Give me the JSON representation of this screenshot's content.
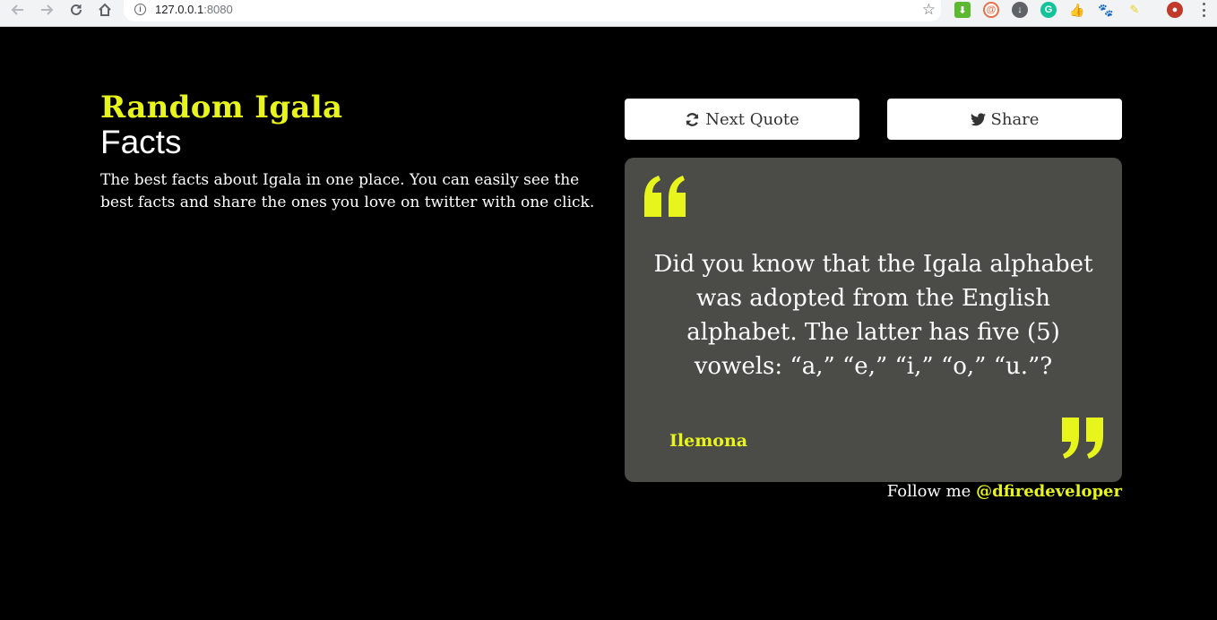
{
  "browser": {
    "url_host": "127.0.0.1",
    "url_port": ":8080",
    "back_icon": "arrow-left-icon",
    "forward_icon": "arrow-right-icon",
    "reload_icon": "reload-icon",
    "home_icon": "home-icon",
    "bookmark_icon": "star-icon",
    "extensions": [
      "download-extension-icon",
      "at-extension-icon",
      "circle-download-icon",
      "grammarly-icon",
      "thumbs-up-icon",
      "paw-icon",
      "sticky-note-icon",
      "profile-avatar"
    ]
  },
  "header": {
    "title_accent": "Random Igala",
    "title_rest": "Facts",
    "description": "The best facts about Igala in one place. You can easily see the best facts and share the ones you love on twitter with one click."
  },
  "actions": {
    "next_label": "Next Quote",
    "next_icon": "refresh-icon",
    "share_label": "Share",
    "share_icon": "twitter-icon"
  },
  "quote": {
    "text": "Did you know that the Igala alphabet was adopted from the English alphabet. The latter has five (5) vowels: “a,” “e,” “i,” “o,” “u.”?",
    "author": "Ilemona"
  },
  "footer": {
    "follow_prefix": "Follow me ",
    "handle": "@dfiredeveloper"
  },
  "colors": {
    "accent": "#e8f51c",
    "background": "#000000",
    "card": "#4b4b47"
  }
}
